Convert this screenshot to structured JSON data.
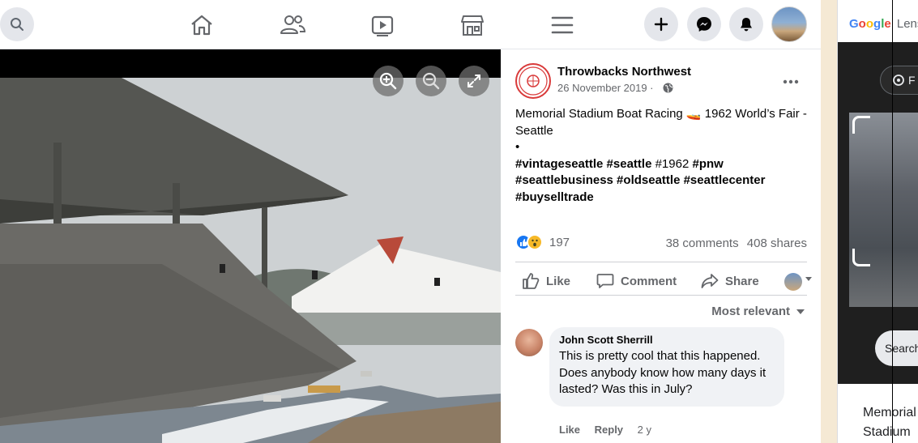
{
  "nav": {
    "icons": [
      "search-icon",
      "home-icon",
      "friends-icon",
      "watch-icon",
      "marketplace-icon",
      "menu-icon",
      "create-plus-icon",
      "messenger-icon",
      "notifications-bell-icon",
      "profile-avatar"
    ]
  },
  "post": {
    "page_name": "Throwbacks Northwest",
    "logo_text": "Throwbacks Northwest",
    "date": "26 November 2019 ·",
    "line1": "Memorial Stadium Boat Racing 🚤 1962 World’s Fair - Seattle",
    "bullet": "•",
    "tags_line1_a": "#vintageseattle #seattle",
    "tags_line1_b": "#1962",
    "tags_line1_c": "#pnw",
    "tags_line2": "#seattlebusiness #oldseattle #seattlecenter",
    "tags_line3": "#buyselltrade",
    "reaction_count": "197",
    "comments": "38 comments",
    "shares": "408 shares",
    "actions": {
      "like": "Like",
      "comment": "Comment",
      "share": "Share"
    },
    "sort_label": "Most relevant"
  },
  "comment": {
    "author": "John Scott Sherrill",
    "text": "This is pretty cool that this happened. Does anybody know how many days it lasted? Was this in July?",
    "like": "Like",
    "reply": "Reply",
    "age": "2 y"
  },
  "lens": {
    "logo_google": "Google",
    "logo_lens": "Lens",
    "pill_text": "F",
    "search_text": "Search",
    "title": "Memorial Stadium"
  },
  "colors": {
    "accent": "#1877f2",
    "muted_text": "#65676b",
    "divider": "#ced0d4"
  }
}
